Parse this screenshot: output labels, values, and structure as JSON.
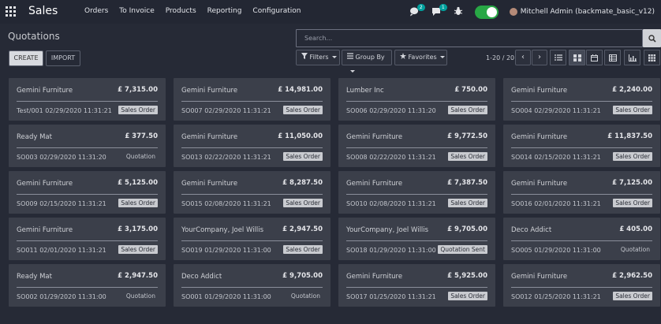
{
  "navbar": {
    "app_name": "Sales",
    "menu": [
      "Orders",
      "To Invoice",
      "Products",
      "Reporting",
      "Configuration"
    ],
    "chat_count": "2",
    "activity_count": "1",
    "user": "Mitchell Admin (backmate_basic_v12)"
  },
  "control_panel": {
    "title": "Quotations",
    "create_label": "CREATE",
    "import_label": "IMPORT",
    "search_placeholder": "Search...",
    "filters_label": "Filters",
    "groupby_label": "Group By",
    "favorites_label": "Favorites",
    "pager": "1-20 / 20"
  },
  "records": [
    {
      "customer": "Gemini Furniture",
      "amount": "£ 7,315.00",
      "reference": "Test/001 02/29/2020 11:31:21",
      "state": "Sales Order"
    },
    {
      "customer": "Gemini Furniture",
      "amount": "£ 14,981.00",
      "reference": "SO007 02/29/2020 11:31:21",
      "state": "Sales Order"
    },
    {
      "customer": "Lumber Inc",
      "amount": "£ 750.00",
      "reference": "SO006 02/29/2020 11:31:20",
      "state": "Sales Order"
    },
    {
      "customer": "Gemini Furniture",
      "amount": "£ 2,240.00",
      "reference": "SO004 02/29/2020 11:31:21",
      "state": "Sales Order"
    },
    {
      "customer": "Ready Mat",
      "amount": "£ 377.50",
      "reference": "SO003 02/29/2020 11:31:20",
      "state": "Quotation"
    },
    {
      "customer": "Gemini Furniture",
      "amount": "£ 11,050.00",
      "reference": "SO013 02/22/2020 11:31:21",
      "state": "Sales Order"
    },
    {
      "customer": "Gemini Furniture",
      "amount": "£ 9,772.50",
      "reference": "SO008 02/22/2020 11:31:21",
      "state": "Sales Order"
    },
    {
      "customer": "Gemini Furniture",
      "amount": "£ 11,837.50",
      "reference": "SO014 02/15/2020 11:31:21",
      "state": "Sales Order"
    },
    {
      "customer": "Gemini Furniture",
      "amount": "£ 5,125.00",
      "reference": "SO009 02/15/2020 11:31:21",
      "state": "Sales Order"
    },
    {
      "customer": "Gemini Furniture",
      "amount": "£ 8,287.50",
      "reference": "SO015 02/08/2020 11:31:21",
      "state": "Sales Order"
    },
    {
      "customer": "Gemini Furniture",
      "amount": "£ 7,387.50",
      "reference": "SO010 02/08/2020 11:31:21",
      "state": "Sales Order"
    },
    {
      "customer": "Gemini Furniture",
      "amount": "£ 7,125.00",
      "reference": "SO016 02/01/2020 11:31:21",
      "state": "Sales Order"
    },
    {
      "customer": "Gemini Furniture",
      "amount": "£ 3,175.00",
      "reference": "SO011 02/01/2020 11:31:21",
      "state": "Sales Order"
    },
    {
      "customer": "YourCompany, Joel Willis",
      "amount": "£ 2,947.50",
      "reference": "SO019 01/29/2020 11:31:00",
      "state": "Sales Order"
    },
    {
      "customer": "YourCompany, Joel Willis",
      "amount": "£ 9,705.00",
      "reference": "SO018 01/29/2020 11:31:00",
      "state": "Quotation Sent"
    },
    {
      "customer": "Deco Addict",
      "amount": "£ 405.00",
      "reference": "SO005 01/29/2020 11:31:00",
      "state": "Quotation"
    },
    {
      "customer": "Ready Mat",
      "amount": "£ 2,947.50",
      "reference": "SO002 01/29/2020 11:31:00",
      "state": "Quotation"
    },
    {
      "customer": "Deco Addict",
      "amount": "£ 9,705.00",
      "reference": "SO001 01/29/2020 11:31:00",
      "state": "Quotation"
    },
    {
      "customer": "Gemini Furniture",
      "amount": "£ 5,925.00",
      "reference": "SO017 01/25/2020 11:31:21",
      "state": "Sales Order"
    },
    {
      "customer": "Gemini Furniture",
      "amount": "£ 2,962.50",
      "reference": "SO012 01/25/2020 11:31:21",
      "state": "Sales Order"
    }
  ]
}
